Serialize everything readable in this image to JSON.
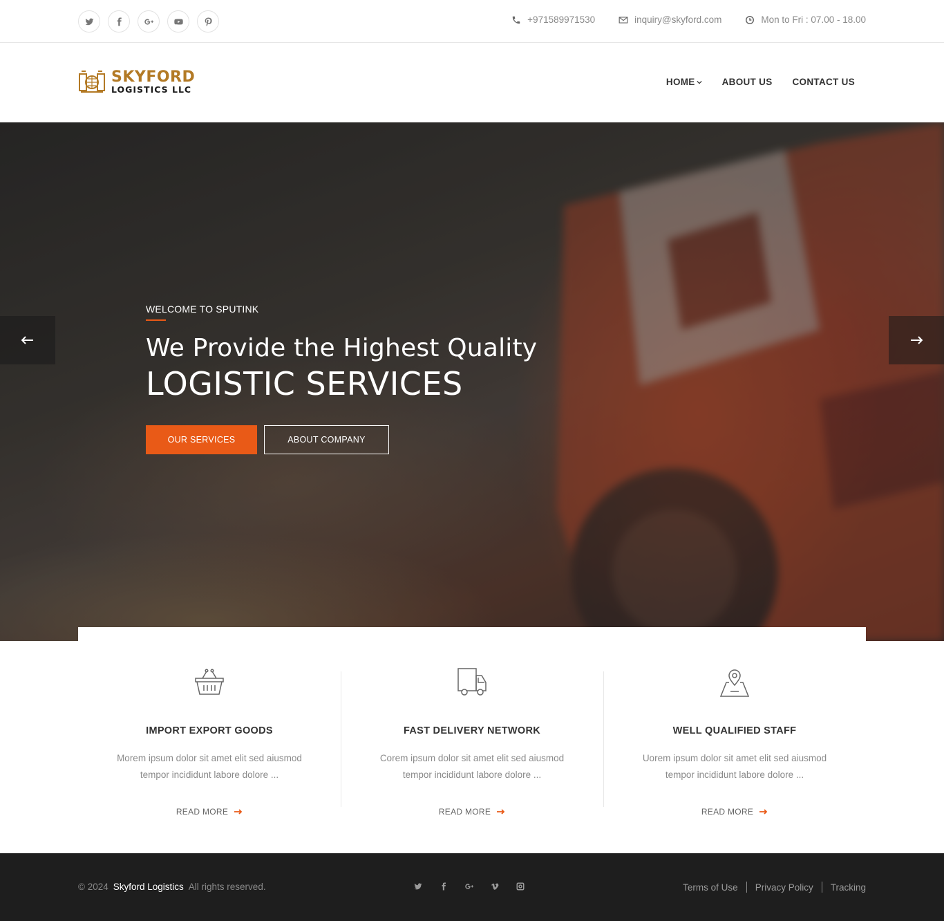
{
  "topbar": {
    "social": [
      "twitter-icon",
      "facebook-icon",
      "google-plus-icon",
      "youtube-icon",
      "pinterest-icon"
    ],
    "phone": "+971589971530",
    "email": "inquiry@skyford.com",
    "hours": "Mon to Fri : 07.00 - 18.00"
  },
  "header": {
    "logo_name": "SKYFORD",
    "logo_sub": "LOGISTICS LLC",
    "nav": [
      {
        "label": "HOME",
        "has_dropdown": true
      },
      {
        "label": "ABOUT US"
      },
      {
        "label": "CONTACT US"
      }
    ]
  },
  "hero": {
    "kicker": "WELCOME TO SPUTINK",
    "title_line1": "We Provide the Highest Quality",
    "title_line2": "LOGISTIC SERVICES",
    "btn_primary": "OUR SERVICES",
    "btn_secondary": "ABOUT COMPANY",
    "accent": "#e95a17"
  },
  "features": [
    {
      "icon": "basket-icon",
      "title": "IMPORT EXPORT GOODS",
      "desc": "Morem ipsum dolor sit amet elit sed aiusmod tempor incididunt labore dolore ...",
      "more": "READ MORE"
    },
    {
      "icon": "truck-icon",
      "title": "FAST DELIVERY NETWORK",
      "desc": "Corem ipsum dolor sit amet elit sed aiusmod tempor incididunt labore dolore ...",
      "more": "READ MORE"
    },
    {
      "icon": "map-pin-icon",
      "title": "WELL QUALIFIED STAFF",
      "desc": "Uorem ipsum dolor sit amet elit sed aiusmod tempor incididunt labore dolore ...",
      "more": "READ MORE"
    }
  ],
  "footer": {
    "copyright": "© 2024",
    "brand": "Skyford Logistics",
    "rights": "All rights reserved.",
    "social": [
      "twitter-icon",
      "facebook-icon",
      "google-plus-icon",
      "vimeo-icon",
      "instagram-icon"
    ],
    "links": [
      "Terms of Use",
      "Privacy Policy",
      "Tracking"
    ]
  }
}
